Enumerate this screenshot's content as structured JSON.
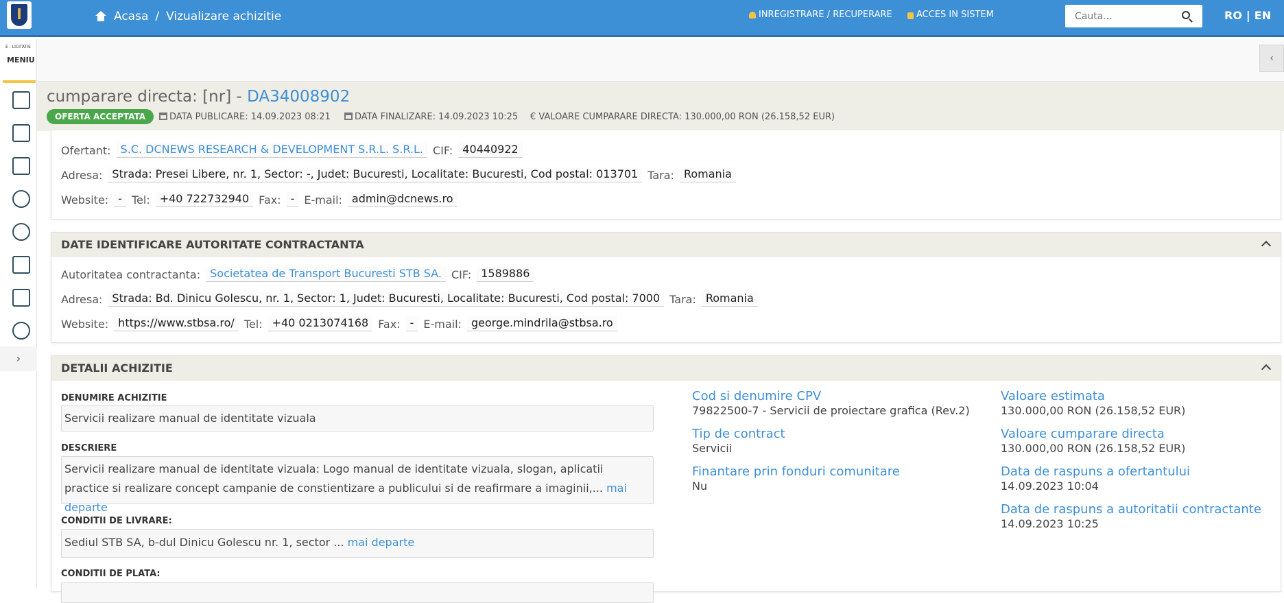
{
  "header": {
    "breadcrumb_home": "Acasa",
    "breadcrumb_sep": "/",
    "breadcrumb_current": "Vizualizare achizitie",
    "register_link": "INREGISTRARE / RECUPERARE",
    "login_link": "ACCES IN SISTEM",
    "search_placeholder": "Cauta...",
    "lang_ro": "RO",
    "lang_sep": "|",
    "lang_en": "EN"
  },
  "sidebar": {
    "brand": "E - LICITATIE",
    "menu_label": "MENIU",
    "expand": "›"
  },
  "title": {
    "prefix": "cumparare directa: [nr] - ",
    "code": "DA34008902"
  },
  "status_badge": "OFERTA ACCEPTATA",
  "meta": {
    "published": "DATA PUBLICARE: 14.09.2023 08:21",
    "finalized": "DATA FINALIZARE: 14.09.2023 10:25",
    "value": "€ VALOARE CUMPARARE DIRECTA: 130.000,00  RON (26.158,52  EUR)"
  },
  "ofertant": {
    "label": "Ofertant:",
    "name": "S.C. DCNEWS RESEARCH & DEVELOPMENT S.R.L. S.R.L.",
    "cif_label": "CIF:",
    "cif": "40440922",
    "address_label": "Adresa:",
    "address": "Strada: Presei Libere, nr. 1, Sector: -, Judet: Bucuresti, Localitate: Bucuresti, Cod postal: 013701",
    "country_label": "Tara:",
    "country": "Romania",
    "website_label": "Website:",
    "website": "-",
    "tel_label": "Tel:",
    "tel": "+40 722732940",
    "fax_label": "Fax:",
    "fax": "-",
    "email_label": "E-mail:",
    "email": "admin@dcnews.ro"
  },
  "authority": {
    "heading": "DATE IDENTIFICARE AUTORITATE CONTRACTANTA",
    "label": "Autoritatea contractanta:",
    "name": "Societatea de Transport Bucuresti STB SA.",
    "cif_label": "CIF:",
    "cif": "1589886",
    "address_label": "Adresa:",
    "address": "Strada: Bd. Dinicu Golescu, nr. 1, Sector: 1, Judet: Bucuresti, Localitate: Bucuresti, Cod postal: 7000",
    "country_label": "Tara:",
    "country": "Romania",
    "website_label": "Website:",
    "website": "https://www.stbsa.ro/",
    "tel_label": "Tel:",
    "tel": "+40 0213074168",
    "fax_label": "Fax:",
    "fax": "-",
    "email_label": "E-mail:",
    "email": "george.mindrila@stbsa.ro"
  },
  "details": {
    "heading": "DETALII ACHIZITIE",
    "name_label": "DENUMIRE ACHIZITIE",
    "name_value": "Servicii realizare manual de identitate vizuala",
    "desc_label": "DESCRIERE",
    "desc_value": "Servicii realizare manual de identitate vizuala: Logo manual de identitate vizuala, slogan, aplicatii practice si realizare concept campanie de constientizare a publicului si de reafirmare a imaginii,... ",
    "more": "mai departe",
    "delivery_label": "CONDITII DE LIVRARE:",
    "delivery_value": "Sediul STB SA, b-dul Dinicu Golescu nr. 1, sector ... ",
    "payment_label": "CONDITII DE PLATA:",
    "cpv_label": "Cod si denumire CPV",
    "cpv_value": "79822500-7 - Servicii de proiectare grafica (Rev.2)",
    "contract_type_label": "Tip de contract",
    "contract_type_value": "Servicii",
    "eu_funds_label": "Finantare prin fonduri comunitare",
    "eu_funds_value": "Nu",
    "estimated_label": "Valoare estimata",
    "estimated_value": "130.000,00  RON (26.158,52  EUR)",
    "direct_value_label": "Valoare cumparare directa",
    "direct_value": "130.000,00  RON (26.158,52  EUR)",
    "bidder_reply_label": "Data de raspuns a ofertantului",
    "bidder_reply_value": "14.09.2023 10:04",
    "authority_reply_label": "Data de raspuns a autoritatii contractante",
    "authority_reply_value": "14.09.2023 10:25"
  }
}
